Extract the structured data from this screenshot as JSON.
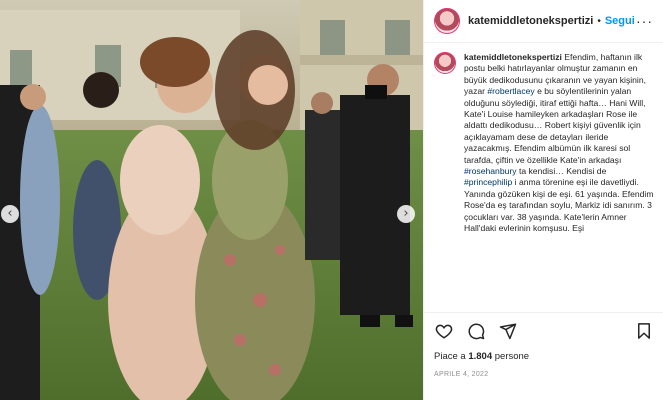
{
  "post": {
    "username": "katemiddletonekspertizi",
    "separator": "•",
    "follow_label": "Segui",
    "more_label": "···"
  },
  "caption": {
    "username": "katemiddletonekspertizi",
    "segments": [
      {
        "text": " Efendim, haftanın ilk postu belki hatırlayanlar olmuştur zamanın en büyük dedikodusunu çıkaranın ve yayan kişinin, yazar ",
        "tag": false
      },
      {
        "text": "#robertlacey",
        "tag": true
      },
      {
        "text": " e bu söylentilerinin yalan olduğunu söylediği, itiraf ettiği hafta… Hani Will, Kate'i Louise hamileyken arkadaşları Rose ile aldattı dedikodusu… Robert kişiyi güvenlik için açıklayamam dese de detayları ileride yazacakmış. Efendim albümün ilk karesi sol tarafda, çiftin ve özellikle Kate'in arkadaşı ",
        "tag": false
      },
      {
        "text": "#rosehanbury",
        "tag": true
      },
      {
        "text": " ta kendisi… Kendisi de ",
        "tag": false
      },
      {
        "text": "#princephilip",
        "tag": true
      },
      {
        "text": " i anma törenine eşi ile davetliydi. Yanında gözüken kişi de eşi. 61 yaşında. Efendim Rose'da eş tarafından soylu, Markiz idi sanırım. 3 çocukları var. 38 yaşında. Kate'lerin Amner Hall'daki evlerinin komşusu. Eşi",
        "tag": false
      }
    ]
  },
  "nav": {
    "prev_icon": "‹",
    "next_icon": "›"
  },
  "likes": {
    "prefix": "Piace a ",
    "count": "1.804",
    "suffix": " persone"
  },
  "date": "APRILE 4, 2022",
  "colors": {
    "accent": "#0095f6",
    "hashtag": "#00376b",
    "muted": "#8e8e8e"
  }
}
